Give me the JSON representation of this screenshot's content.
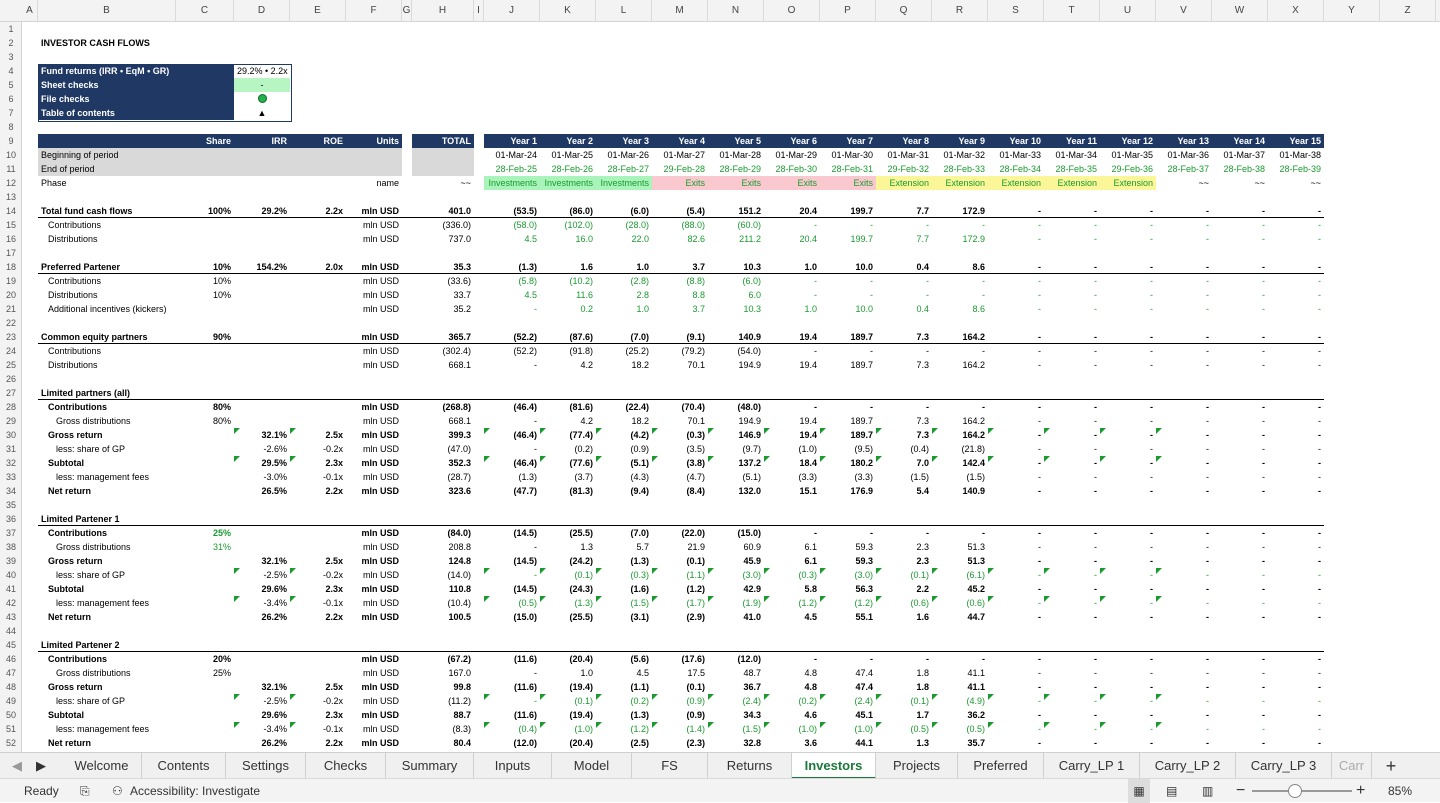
{
  "app": {
    "title": "Investors"
  },
  "col_headers": [
    "A",
    "B",
    "C",
    "D",
    "E",
    "F",
    "G",
    "H",
    "I",
    "J",
    "K",
    "L",
    "M",
    "N",
    "O",
    "P",
    "Q",
    "R",
    "S",
    "T",
    "U",
    "V",
    "W",
    "X",
    "Y",
    "Z"
  ],
  "title": "INVESTOR CASH FLOWS",
  "checks": {
    "fund_returns_label": "Fund returns (IRR • EqM • GR)",
    "fund_returns_value": "29.2% • 2.2x • 401.0",
    "sheet_checks_label": "Sheet checks",
    "sheet_checks_value": "-",
    "file_checks_label": "File checks",
    "toc_label": "Table of contents",
    "toc_value": "▲"
  },
  "header": {
    "share": "Share",
    "irr": "IRR",
    "roe": "ROE",
    "units": "Units",
    "total": "TOTAL",
    "years": [
      "Year 1",
      "Year 2",
      "Year 3",
      "Year 4",
      "Year 5",
      "Year 6",
      "Year 7",
      "Year 8",
      "Year 9",
      "Year 10",
      "Year 11",
      "Year 12",
      "Year 13",
      "Year 14",
      "Year 15"
    ]
  },
  "period": {
    "beginning_label": "Beginning of period",
    "end_label": "End of period",
    "phase_label": "Phase",
    "phase_units": "name",
    "phase_total": "~~",
    "beginning": [
      "01-Mar-24",
      "01-Mar-25",
      "01-Mar-26",
      "01-Mar-27",
      "01-Mar-28",
      "01-Mar-29",
      "01-Mar-30",
      "01-Mar-31",
      "01-Mar-32",
      "01-Mar-33",
      "01-Mar-34",
      "01-Mar-35",
      "01-Mar-36",
      "01-Mar-37",
      "01-Mar-38"
    ],
    "end": [
      "28-Feb-25",
      "28-Feb-26",
      "28-Feb-27",
      "29-Feb-28",
      "28-Feb-29",
      "28-Feb-30",
      "28-Feb-31",
      "29-Feb-32",
      "28-Feb-33",
      "28-Feb-34",
      "28-Feb-35",
      "29-Feb-36",
      "28-Feb-37",
      "28-Feb-38",
      "28-Feb-39"
    ],
    "phases": [
      "Investments",
      "Investments",
      "Investments",
      "Exits",
      "Exits",
      "Exits",
      "Exits",
      "Extension",
      "Extension",
      "Extension",
      "Extension",
      "Extension",
      "~~",
      "~~",
      "~~"
    ]
  },
  "rows": [
    {
      "r": 14,
      "label": "Total fund cash flows",
      "bold": true,
      "ul": true,
      "share": "100%",
      "irr": "29.2%",
      "roe": "2.2x",
      "units": "mln USD",
      "total": "401.0",
      "years": [
        "(53.5)",
        "(86.0)",
        "(6.0)",
        "(5.4)",
        "151.2",
        "20.4",
        "199.7",
        "7.7",
        "172.9",
        "-",
        "-",
        "-",
        "-",
        "-",
        "-"
      ]
    },
    {
      "r": 15,
      "label": "Contributions",
      "ind": 1,
      "units": "mln USD",
      "total": "(336.0)",
      "green": true,
      "years": [
        "(58.0)",
        "(102.0)",
        "(28.0)",
        "(88.0)",
        "(60.0)",
        "-",
        "-",
        "-",
        "-",
        "-",
        "-",
        "-",
        "-",
        "-",
        "-"
      ]
    },
    {
      "r": 16,
      "label": "Distributions",
      "ind": 1,
      "units": "mln USD",
      "total": "737.0",
      "green": true,
      "years": [
        "4.5",
        "16.0",
        "22.0",
        "82.6",
        "211.2",
        "20.4",
        "199.7",
        "7.7",
        "172.9",
        "-",
        "-",
        "-",
        "-",
        "-",
        "-"
      ]
    },
    {
      "r": 18,
      "label": "Preferred Partener",
      "bold": true,
      "ul": true,
      "share": "10%",
      "irr": "154.2%",
      "roe": "2.0x",
      "units": "mln USD",
      "total": "35.3",
      "years": [
        "(1.3)",
        "1.6",
        "1.0",
        "3.7",
        "10.3",
        "1.0",
        "10.0",
        "0.4",
        "8.6",
        "-",
        "-",
        "-",
        "-",
        "-",
        "-"
      ]
    },
    {
      "r": 19,
      "label": "Contributions",
      "ind": 1,
      "share": "10%",
      "units": "mln USD",
      "total": "(33.6)",
      "green": true,
      "years": [
        "(5.8)",
        "(10.2)",
        "(2.8)",
        "(8.8)",
        "(6.0)",
        "-",
        "-",
        "-",
        "-",
        "-",
        "-",
        "-",
        "-",
        "-",
        "-"
      ]
    },
    {
      "r": 20,
      "label": "Distributions",
      "ind": 1,
      "share": "10%",
      "units": "mln USD",
      "total": "33.7",
      "green": true,
      "years": [
        "4.5",
        "11.6",
        "2.8",
        "8.8",
        "6.0",
        "-",
        "-",
        "-",
        "-",
        "-",
        "-",
        "-",
        "-",
        "-",
        "-"
      ]
    },
    {
      "r": 21,
      "label": "Additional incentives (kickers)",
      "ind": 1,
      "units": "mln USD",
      "total": "35.2",
      "green": true,
      "years": [
        "-",
        "0.2",
        "1.0",
        "3.7",
        "10.3",
        "1.0",
        "10.0",
        "0.4",
        "8.6",
        "-",
        "-",
        "-",
        "-",
        "-",
        "-"
      ]
    },
    {
      "r": 23,
      "label": "Common equity partners",
      "bold": true,
      "ul": true,
      "share": "90%",
      "units": "mln USD",
      "total": "365.7",
      "years": [
        "(52.2)",
        "(87.6)",
        "(7.0)",
        "(9.1)",
        "140.9",
        "19.4",
        "189.7",
        "7.3",
        "164.2",
        "-",
        "-",
        "-",
        "-",
        "-",
        "-"
      ]
    },
    {
      "r": 24,
      "label": "Contributions",
      "ind": 1,
      "units": "mln USD",
      "total": "(302.4)",
      "years": [
        "(52.2)",
        "(91.8)",
        "(25.2)",
        "(79.2)",
        "(54.0)",
        "-",
        "-",
        "-",
        "-",
        "-",
        "-",
        "-",
        "-",
        "-",
        "-"
      ]
    },
    {
      "r": 25,
      "label": "Distributions",
      "ind": 1,
      "units": "mln USD",
      "total": "668.1",
      "years": [
        "-",
        "4.2",
        "18.2",
        "70.1",
        "194.9",
        "19.4",
        "189.7",
        "7.3",
        "164.2",
        "-",
        "-",
        "-",
        "-",
        "-",
        "-"
      ]
    },
    {
      "r": 27,
      "label": "Limited partners (all)",
      "bold": true,
      "ul": true,
      "years": []
    },
    {
      "r": 28,
      "label": "Contributions",
      "bold": true,
      "ind": 1,
      "share": "80%",
      "units": "mln USD",
      "total": "(268.8)",
      "years": [
        "(46.4)",
        "(81.6)",
        "(22.4)",
        "(70.4)",
        "(48.0)",
        "-",
        "-",
        "-",
        "-",
        "-",
        "-",
        "-",
        "-",
        "-",
        "-"
      ]
    },
    {
      "r": 29,
      "label": "Gross distributions",
      "ind": 2,
      "share": "80%",
      "units": "mln USD",
      "total": "668.1",
      "years": [
        "-",
        "4.2",
        "18.2",
        "70.1",
        "194.9",
        "19.4",
        "189.7",
        "7.3",
        "164.2",
        "-",
        "-",
        "-",
        "-",
        "-",
        "-"
      ]
    },
    {
      "r": 30,
      "label": "Gross return",
      "bold": true,
      "ind": 1,
      "irr": "32.1%",
      "roe": "2.5x",
      "units": "mln USD",
      "total": "399.3",
      "tri": true,
      "years": [
        "(46.4)",
        "(77.4)",
        "(4.2)",
        "(0.3)",
        "146.9",
        "19.4",
        "189.7",
        "7.3",
        "164.2",
        "-",
        "-",
        "-",
        "-",
        "-",
        "-"
      ]
    },
    {
      "r": 31,
      "label": "less: share of GP",
      "ind": 2,
      "irr": "-2.6%",
      "roe": "-0.2x",
      "units": "mln USD",
      "total": "(47.0)",
      "years": [
        "-",
        "(0.2)",
        "(0.9)",
        "(3.5)",
        "(9.7)",
        "(1.0)",
        "(9.5)",
        "(0.4)",
        "(21.8)",
        "-",
        "-",
        "-",
        "-",
        "-",
        "-"
      ]
    },
    {
      "r": 32,
      "label": "Subtotal",
      "bold": true,
      "ind": 1,
      "irr": "29.5%",
      "roe": "2.3x",
      "units": "mln USD",
      "total": "352.3",
      "tri": true,
      "years": [
        "(46.4)",
        "(77.6)",
        "(5.1)",
        "(3.8)",
        "137.2",
        "18.4",
        "180.2",
        "7.0",
        "142.4",
        "-",
        "-",
        "-",
        "-",
        "-",
        "-"
      ]
    },
    {
      "r": 33,
      "label": "less: management fees",
      "ind": 2,
      "irr": "-3.0%",
      "roe": "-0.1x",
      "units": "mln USD",
      "total": "(28.7)",
      "years": [
        "(1.3)",
        "(3.7)",
        "(4.3)",
        "(4.7)",
        "(5.1)",
        "(3.3)",
        "(3.3)",
        "(1.5)",
        "(1.5)",
        "-",
        "-",
        "-",
        "-",
        "-",
        "-"
      ]
    },
    {
      "r": 34,
      "label": "Net return",
      "bold": true,
      "ind": 1,
      "irr": "26.5%",
      "roe": "2.2x",
      "units": "mln USD",
      "total": "323.6",
      "years": [
        "(47.7)",
        "(81.3)",
        "(9.4)",
        "(8.4)",
        "132.0",
        "15.1",
        "176.9",
        "5.4",
        "140.9",
        "-",
        "-",
        "-",
        "-",
        "-",
        "-"
      ]
    },
    {
      "r": 36,
      "label": "Limited Partener 1",
      "bold": true,
      "ul": true,
      "years": []
    },
    {
      "r": 37,
      "label": "Contributions",
      "bold": true,
      "ind": 1,
      "share": "25%",
      "sharegreen": true,
      "units": "mln USD",
      "total": "(84.0)",
      "years": [
        "(14.5)",
        "(25.5)",
        "(7.0)",
        "(22.0)",
        "(15.0)",
        "-",
        "-",
        "-",
        "-",
        "-",
        "-",
        "-",
        "-",
        "-",
        "-"
      ]
    },
    {
      "r": 38,
      "label": "Gross distributions",
      "ind": 2,
      "share": "31%",
      "sharegreen": true,
      "units": "mln USD",
      "total": "208.8",
      "years": [
        "-",
        "1.3",
        "5.7",
        "21.9",
        "60.9",
        "6.1",
        "59.3",
        "2.3",
        "51.3",
        "-",
        "-",
        "-",
        "-",
        "-",
        "-"
      ]
    },
    {
      "r": 39,
      "label": "Gross return",
      "bold": true,
      "ind": 1,
      "irr": "32.1%",
      "roe": "2.5x",
      "units": "mln USD",
      "total": "124.8",
      "years": [
        "(14.5)",
        "(24.2)",
        "(1.3)",
        "(0.1)",
        "45.9",
        "6.1",
        "59.3",
        "2.3",
        "51.3",
        "-",
        "-",
        "-",
        "-",
        "-",
        "-"
      ]
    },
    {
      "r": 40,
      "label": "less: share of GP",
      "ind": 2,
      "irr": "-2.5%",
      "roe": "-0.2x",
      "units": "mln USD",
      "total": "(14.0)",
      "green": true,
      "tri": true,
      "years": [
        "-",
        "(0.1)",
        "(0.3)",
        "(1.1)",
        "(3.0)",
        "(0.3)",
        "(3.0)",
        "(0.1)",
        "(6.1)",
        "-",
        "-",
        "-",
        "-",
        "-",
        "-"
      ]
    },
    {
      "r": 41,
      "label": "Subtotal",
      "bold": true,
      "ind": 1,
      "irr": "29.6%",
      "roe": "2.3x",
      "units": "mln USD",
      "total": "110.8",
      "years": [
        "(14.5)",
        "(24.3)",
        "(1.6)",
        "(1.2)",
        "42.9",
        "5.8",
        "56.3",
        "2.2",
        "45.2",
        "-",
        "-",
        "-",
        "-",
        "-",
        "-"
      ]
    },
    {
      "r": 42,
      "label": "less: management fees",
      "ind": 2,
      "irr": "-3.4%",
      "roe": "-0.1x",
      "units": "mln USD",
      "total": "(10.4)",
      "green": true,
      "tri": true,
      "years": [
        "(0.5)",
        "(1.3)",
        "(1.5)",
        "(1.7)",
        "(1.9)",
        "(1.2)",
        "(1.2)",
        "(0.6)",
        "(0.6)",
        "-",
        "-",
        "-",
        "-",
        "-",
        "-"
      ]
    },
    {
      "r": 43,
      "label": "Net return",
      "bold": true,
      "ind": 1,
      "irr": "26.2%",
      "roe": "2.2x",
      "units": "mln USD",
      "total": "100.5",
      "years": [
        "(15.0)",
        "(25.5)",
        "(3.1)",
        "(2.9)",
        "41.0",
        "4.5",
        "55.1",
        "1.6",
        "44.7",
        "-",
        "-",
        "-",
        "-",
        "-",
        "-"
      ]
    },
    {
      "r": 45,
      "label": "Limited Partener 2",
      "bold": true,
      "ul": true,
      "years": []
    },
    {
      "r": 46,
      "label": "Contributions",
      "bold": true,
      "ind": 1,
      "share": "20%",
      "units": "mln USD",
      "total": "(67.2)",
      "years": [
        "(11.6)",
        "(20.4)",
        "(5.6)",
        "(17.6)",
        "(12.0)",
        "-",
        "-",
        "-",
        "-",
        "-",
        "-",
        "-",
        "-",
        "-",
        "-"
      ]
    },
    {
      "r": 47,
      "label": "Gross distributions",
      "ind": 2,
      "share": "25%",
      "units": "mln USD",
      "total": "167.0",
      "years": [
        "-",
        "1.0",
        "4.5",
        "17.5",
        "48.7",
        "4.8",
        "47.4",
        "1.8",
        "41.1",
        "-",
        "-",
        "-",
        "-",
        "-",
        "-"
      ]
    },
    {
      "r": 48,
      "label": "Gross return",
      "bold": true,
      "ind": 1,
      "irr": "32.1%",
      "roe": "2.5x",
      "units": "mln USD",
      "total": "99.8",
      "years": [
        "(11.6)",
        "(19.4)",
        "(1.1)",
        "(0.1)",
        "36.7",
        "4.8",
        "47.4",
        "1.8",
        "41.1",
        "-",
        "-",
        "-",
        "-",
        "-",
        "-"
      ]
    },
    {
      "r": 49,
      "label": "less: share of GP",
      "ind": 2,
      "irr": "-2.5%",
      "roe": "-0.2x",
      "units": "mln USD",
      "total": "(11.2)",
      "green": true,
      "tri": true,
      "years": [
        "-",
        "(0.1)",
        "(0.2)",
        "(0.9)",
        "(2.4)",
        "(0.2)",
        "(2.4)",
        "(0.1)",
        "(4.9)",
        "-",
        "-",
        "-",
        "-",
        "-",
        "-"
      ]
    },
    {
      "r": 50,
      "label": "Subtotal",
      "bold": true,
      "ind": 1,
      "irr": "29.6%",
      "roe": "2.3x",
      "units": "mln USD",
      "total": "88.7",
      "years": [
        "(11.6)",
        "(19.4)",
        "(1.3)",
        "(0.9)",
        "34.3",
        "4.6",
        "45.1",
        "1.7",
        "36.2",
        "-",
        "-",
        "-",
        "-",
        "-",
        "-"
      ]
    },
    {
      "r": 51,
      "label": "less: management fees",
      "ind": 2,
      "irr": "-3.4%",
      "roe": "-0.1x",
      "units": "mln USD",
      "total": "(8.3)",
      "green": true,
      "tri": true,
      "years": [
        "(0.4)",
        "(1.0)",
        "(1.2)",
        "(1.4)",
        "(1.5)",
        "(1.0)",
        "(1.0)",
        "(0.5)",
        "(0.5)",
        "-",
        "-",
        "-",
        "-",
        "-",
        "-"
      ]
    },
    {
      "r": 52,
      "label": "Net return",
      "bold": true,
      "ind": 1,
      "irr": "26.2%",
      "roe": "2.2x",
      "units": "mln USD",
      "total": "80.4",
      "years": [
        "(12.0)",
        "(20.4)",
        "(2.5)",
        "(2.3)",
        "32.8",
        "3.6",
        "44.1",
        "1.3",
        "35.7",
        "-",
        "-",
        "-",
        "-",
        "-",
        "-"
      ]
    }
  ],
  "tabs": [
    "Welcome",
    "Contents",
    "Settings",
    "Checks",
    "Summary",
    "Inputs",
    "Model",
    "FS",
    "Returns",
    "Investors",
    "Projects",
    "Preferred",
    "Carry_LP 1",
    "Carry_LP 2",
    "Carry_LP 3",
    "Carr"
  ],
  "active_tab": "Investors",
  "status": {
    "ready": "Ready",
    "accessibility": "Accessibility: Investigate",
    "zoom": "85%"
  }
}
